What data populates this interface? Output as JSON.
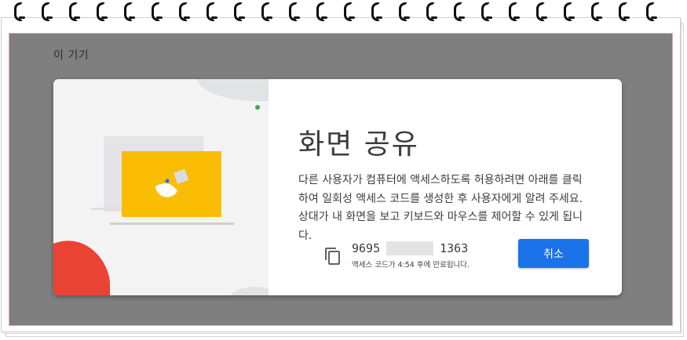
{
  "background_title": "이 기기",
  "dialog": {
    "title": "화면 공유",
    "description": "다른 사용자가 컴퓨터에 액세스하도록 허용하려면 아래를 클릭하여 일회성 액세스 코드를 생성한 후 사용자에게 알려 주세요. 상대가 내 화면을 보고 키보드와 마우스를 제어할 수 있게 됩니다.",
    "access_code_part1": "9695",
    "access_code_part2": "1363",
    "expiry_text": "액세스 코드가 4:54 후에 만료됩니다.",
    "cancel_label": "취소"
  },
  "icons": {
    "copy": "copy-icon"
  },
  "colors": {
    "accent": "#1a73e8",
    "illustration_yellow": "#fbbc04",
    "illustration_red": "#ea4335",
    "status_green": "#34a853",
    "overlay": "#7f7f7f"
  }
}
